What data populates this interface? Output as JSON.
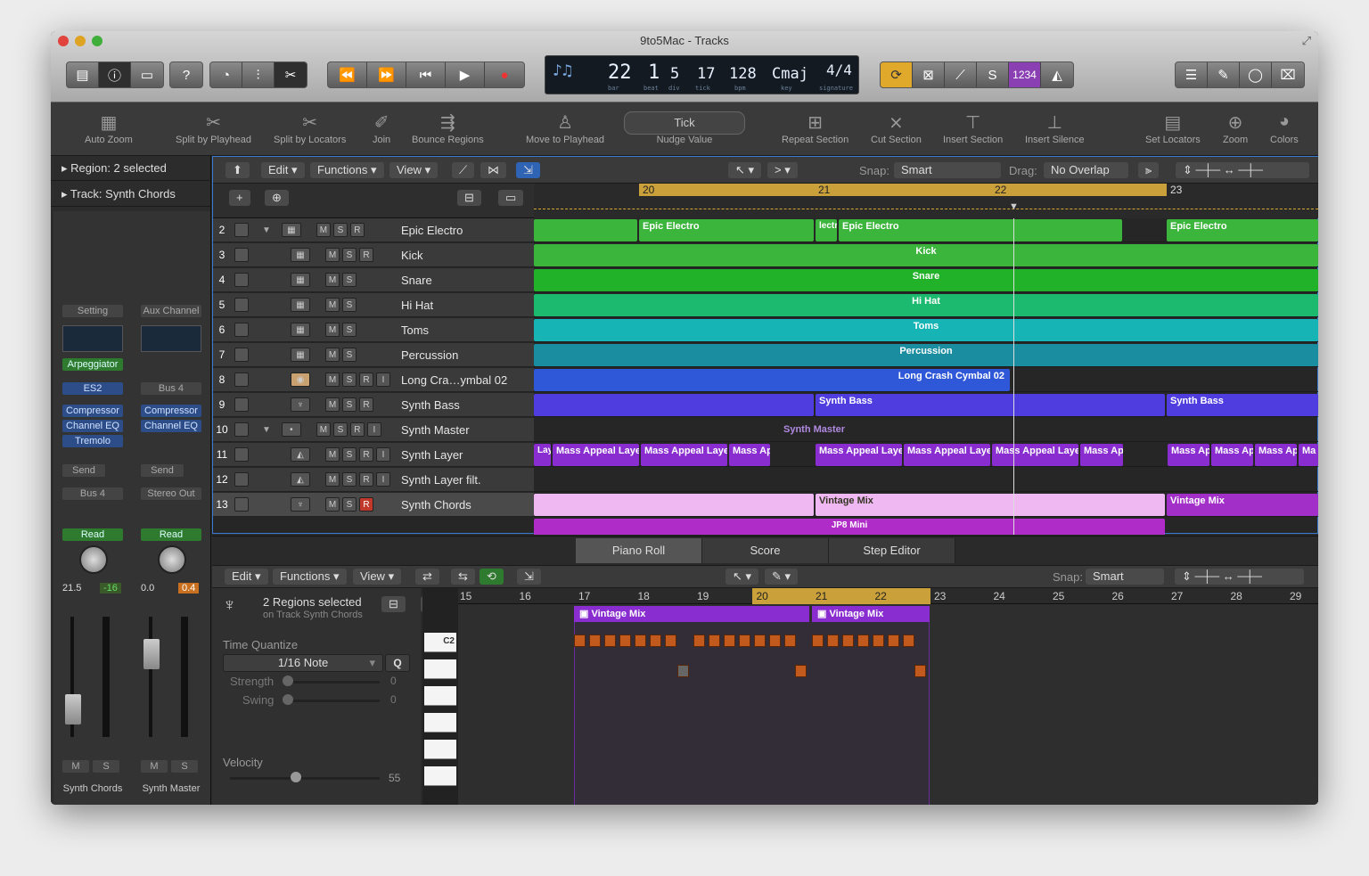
{
  "window": {
    "title": "9to5Mac - Tracks"
  },
  "lcd": {
    "bar": "22",
    "beat": "1",
    "div": "5",
    "tick": "17",
    "bpm": "128",
    "key": "Cmaj",
    "sig": "4/4",
    "l_bar": "bar",
    "l_beat": "beat",
    "l_div": "div",
    "l_tick": "tick",
    "l_bpm": "bpm",
    "l_key": "key",
    "l_sig": "signature"
  },
  "right_badge": "1234",
  "toolbar": [
    {
      "label": "Auto Zoom",
      "icon": "auto-zoom-icon"
    },
    {
      "label": "Split by Playhead",
      "icon": "scissors-icon"
    },
    {
      "label": "Split by Locators",
      "icon": "scissors-locators-icon"
    },
    {
      "label": "Join",
      "icon": "glue-icon"
    },
    {
      "label": "Bounce Regions",
      "icon": "bounce-icon"
    },
    {
      "label": "Move to Playhead",
      "icon": "joystick-icon"
    },
    {
      "label": "Nudge Value",
      "icon": "nudge-icon"
    },
    {
      "label": "Repeat Section",
      "icon": "repeat-icon"
    },
    {
      "label": "Cut Section",
      "icon": "cut-section-icon"
    },
    {
      "label": "Insert Section",
      "icon": "insert-section-icon"
    },
    {
      "label": "Insert Silence",
      "icon": "insert-silence-icon"
    },
    {
      "label": "Set Locators",
      "icon": "locators-icon"
    },
    {
      "label": "Zoom",
      "icon": "zoom-icon"
    },
    {
      "label": "Colors",
      "icon": "palette-icon"
    }
  ],
  "nudge": {
    "value": "Tick"
  },
  "inspector": {
    "region": "Region: 2 selected",
    "track": "Track:  Synth Chords",
    "left": {
      "setting": "Setting",
      "plugin": "Arpeggiator",
      "inst": "ES2",
      "fx": [
        "Compressor",
        "Channel EQ",
        "Tremolo"
      ],
      "send": "Send",
      "bus": "Bus 4",
      "mode": "Read",
      "vol": "21.5",
      "pan": "-16",
      "m": "M",
      "s": "S",
      "name": "Synth Chords"
    },
    "right": {
      "setting": "Aux Channel",
      "bus": "Bus 4",
      "fx": [
        "Compressor",
        "Channel EQ"
      ],
      "send": "Send",
      "out": "Stereo Out",
      "mode": "Read",
      "vol": "0.0",
      "pan": "0.4",
      "m": "M",
      "s": "S",
      "name": "Synth Master"
    }
  },
  "tracks_menu": {
    "edit": "Edit",
    "functions": "Functions",
    "view": "View",
    "snap_label": "Snap:",
    "snap": "Smart",
    "drag_label": "Drag:",
    "drag": "No Overlap"
  },
  "ruler": [
    "20",
    "21",
    "22",
    "23"
  ],
  "tracks": [
    {
      "num": "2",
      "name": "Epic Electro",
      "color": "#2fa92f"
    },
    {
      "num": "3",
      "name": "Kick",
      "color": "#2fa92f"
    },
    {
      "num": "4",
      "name": "Snare",
      "color": "#2fa92f"
    },
    {
      "num": "5",
      "name": "Hi Hat",
      "color": "#1aa766"
    },
    {
      "num": "6",
      "name": "Toms",
      "color": "#13a6a6"
    },
    {
      "num": "7",
      "name": "Percussion",
      "color": "#1b8a98"
    },
    {
      "num": "8",
      "name": "Long Cra…ymbal 02",
      "color": "#2c55c8"
    },
    {
      "num": "9",
      "name": "Synth Bass",
      "color": "#4a3ad0"
    },
    {
      "num": "10",
      "name": "Synth Master",
      "color": "#6a35c8"
    },
    {
      "num": "11",
      "name": "Synth Layer",
      "color": "#7a2ac0"
    },
    {
      "num": "12",
      "name": "Synth Layer filt.",
      "color": "#7a2ac0"
    },
    {
      "num": "13",
      "name": "Synth Chords",
      "color": "#8a28c0"
    }
  ],
  "regions": {
    "epic": "Epic Electro",
    "epic_cut": "lectr",
    "kick": "Kick",
    "snare": "Snare",
    "hihat": "Hi Hat",
    "toms": "Toms",
    "perc": "Percussion",
    "cymbal": "Long Crash Cymbal 02",
    "bass": "Synth Bass",
    "master": "Synth Master",
    "mass": "Mass Appeal Laye",
    "mass_short": "Mass Ap",
    "mass_tiny": "Ma",
    "laye": "Laye",
    "vintage": "Vintage Mix",
    "jp8": "JP8 Mini"
  },
  "editor": {
    "tabs": [
      "Piano Roll",
      "Score",
      "Step Editor"
    ],
    "edit": "Edit",
    "functions": "Functions",
    "view": "View",
    "snap_label": "Snap:",
    "snap": "Smart",
    "sel_title": "2 Regions selected",
    "sel_sub": "on Track Synth Chords",
    "tq_label": "Time Quantize",
    "tq_value": "1/16 Note",
    "q": "Q",
    "strength": "Strength",
    "strength_val": "0",
    "swing": "Swing",
    "swing_val": "0",
    "velocity": "Velocity",
    "velocity_val": "55",
    "key_label": "C2",
    "ruler": [
      "15",
      "16",
      "17",
      "18",
      "19",
      "20",
      "21",
      "22",
      "23",
      "24",
      "25",
      "26",
      "27",
      "28",
      "29"
    ],
    "region_name": "Vintage Mix"
  }
}
